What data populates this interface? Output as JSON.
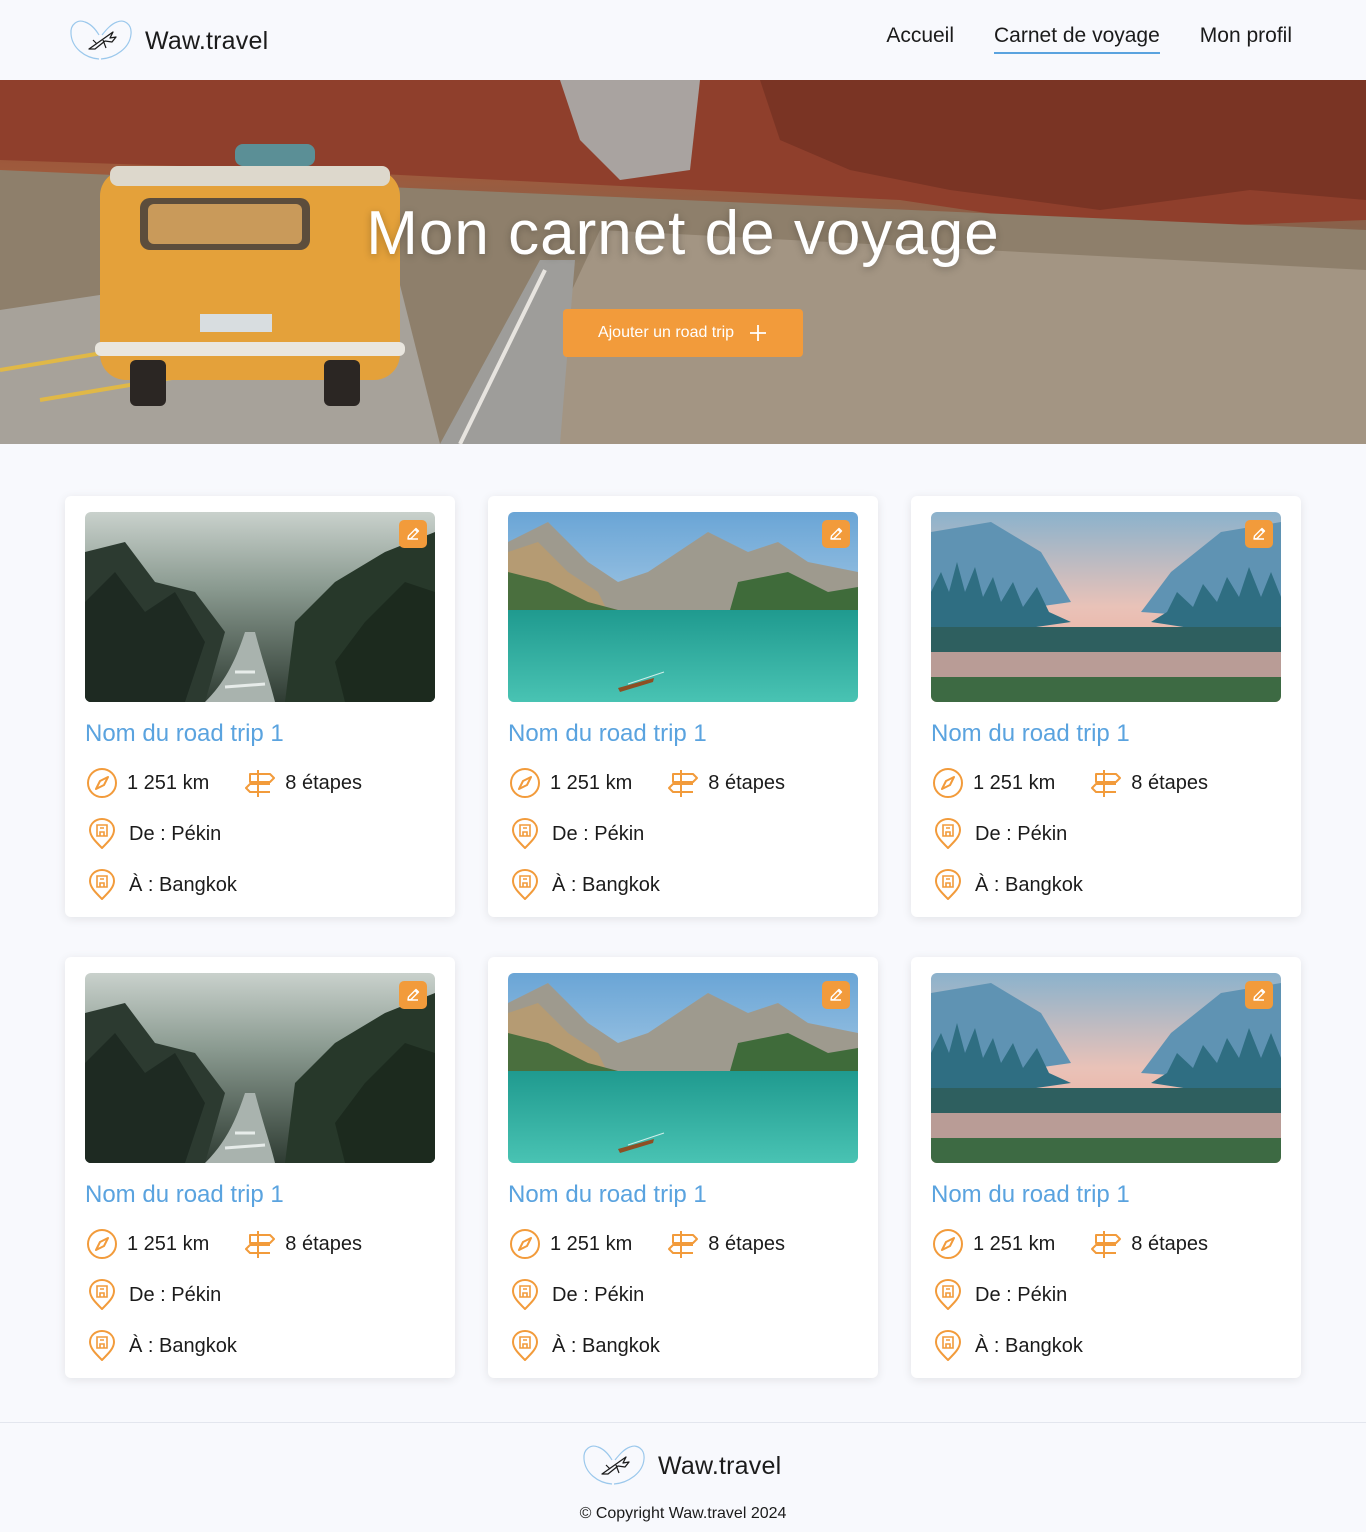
{
  "header": {
    "brand": "Waw.travel",
    "nav": [
      {
        "label": "Accueil",
        "active": false
      },
      {
        "label": "Carnet de voyage",
        "active": true
      },
      {
        "label": "Mon profil",
        "active": false
      }
    ]
  },
  "hero": {
    "title": "Mon carnet de  voyage",
    "button_label": "Ajouter un road trip",
    "button_icon": "plus-icon"
  },
  "cards": [
    {
      "title": "Nom du road trip 1",
      "distance": "1 251 km",
      "steps": "8 étapes",
      "from": "De : Pékin",
      "to": "À : Bangkok",
      "image": "misty-forest-river"
    },
    {
      "title": "Nom du road trip 1",
      "distance": "1 251 km",
      "steps": "8 étapes",
      "from": "De : Pékin",
      "to": "À : Bangkok",
      "image": "mountain-lake-boat"
    },
    {
      "title": "Nom du road trip 1",
      "distance": "1 251 km",
      "steps": "8 étapes",
      "from": "De : Pékin",
      "to": "À : Bangkok",
      "image": "valley-sunset-river"
    },
    {
      "title": "Nom du road trip 1",
      "distance": "1 251 km",
      "steps": "8 étapes",
      "from": "De : Pékin",
      "to": "À : Bangkok",
      "image": "misty-forest-river"
    },
    {
      "title": "Nom du road trip 1",
      "distance": "1 251 km",
      "steps": "8 étapes",
      "from": "De : Pékin",
      "to": "À : Bangkok",
      "image": "mountain-lake-boat"
    },
    {
      "title": "Nom du road trip 1",
      "distance": "1 251 km",
      "steps": "8 étapes",
      "from": "De : Pékin",
      "to": "À : Bangkok",
      "image": "valley-sunset-river"
    }
  ],
  "footer": {
    "brand": "Waw.travel",
    "copyright": "© Copyright Waw.travel 2024"
  },
  "colors": {
    "accent": "#f29b3b",
    "link": "#5aa3df",
    "background": "#f8f9fd",
    "text": "#1b1b1b"
  }
}
